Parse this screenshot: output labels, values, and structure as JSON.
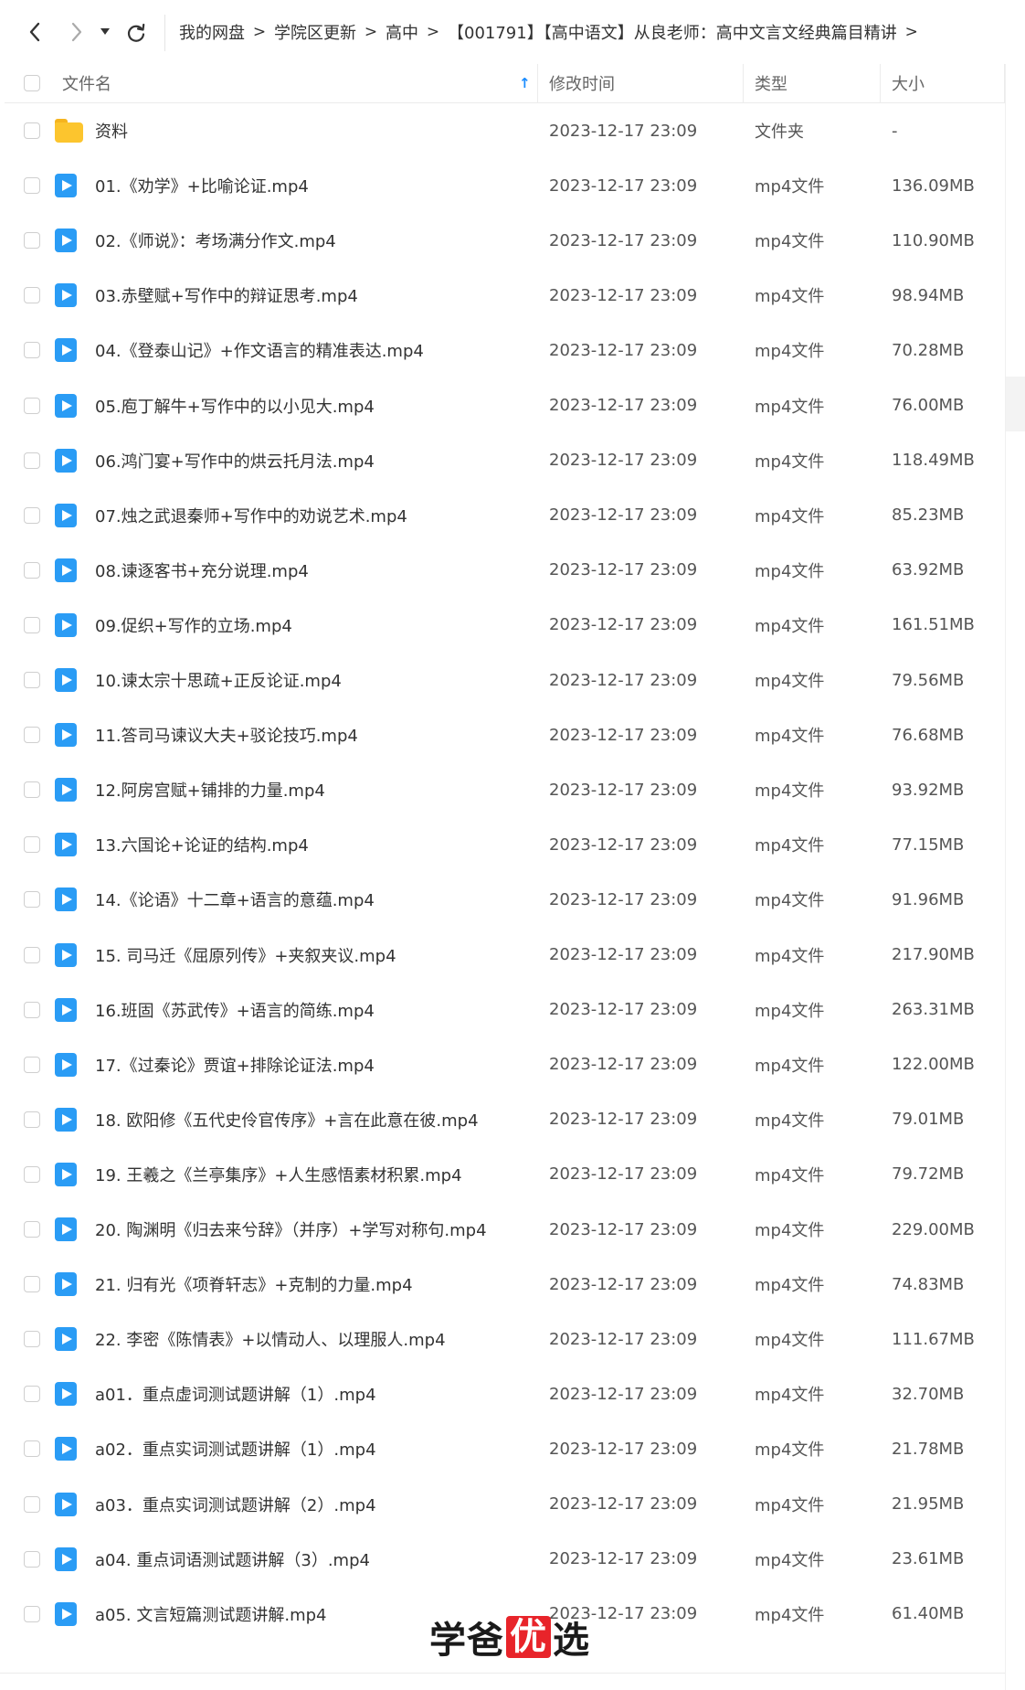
{
  "nav": {
    "breadcrumb": [
      "我的网盘",
      "学院区更新",
      "高中",
      "【001791】【高中语文】从良老师：高中文言文经典篇目精讲"
    ],
    "separator": ">"
  },
  "header": {
    "name_label": "文件名",
    "time_label": "修改时间",
    "type_label": "类型",
    "size_label": "大小",
    "sort_indicator": "↑"
  },
  "rows": [
    {
      "icon": "folder-icon",
      "name": "资料",
      "time": "2023-12-17 23:09",
      "type": "文件夹",
      "size": "-"
    },
    {
      "icon": "video-file-icon",
      "name": "01.《劝学》+比喻论证.mp4",
      "time": "2023-12-17 23:09",
      "type": "mp4文件",
      "size": "136.09MB"
    },
    {
      "icon": "video-file-icon",
      "name": "02.《师说》：考场满分作文.mp4",
      "time": "2023-12-17 23:09",
      "type": "mp4文件",
      "size": "110.90MB"
    },
    {
      "icon": "video-file-icon",
      "name": "03.赤壁赋+写作中的辩证思考.mp4",
      "time": "2023-12-17 23:09",
      "type": "mp4文件",
      "size": "98.94MB"
    },
    {
      "icon": "video-file-icon",
      "name": "04.《登泰山记》+作文语言的精准表达.mp4",
      "time": "2023-12-17 23:09",
      "type": "mp4文件",
      "size": "70.28MB"
    },
    {
      "icon": "video-file-icon",
      "name": "05.庖丁解牛+写作中的以小见大.mp4",
      "time": "2023-12-17 23:09",
      "type": "mp4文件",
      "size": "76.00MB"
    },
    {
      "icon": "video-file-icon",
      "name": "06.鸿门宴+写作中的烘云托月法.mp4",
      "time": "2023-12-17 23:09",
      "type": "mp4文件",
      "size": "118.49MB"
    },
    {
      "icon": "video-file-icon",
      "name": "07.烛之武退秦师+写作中的劝说艺术.mp4",
      "time": "2023-12-17 23:09",
      "type": "mp4文件",
      "size": "85.23MB"
    },
    {
      "icon": "video-file-icon",
      "name": "08.谏逐客书+充分说理.mp4",
      "time": "2023-12-17 23:09",
      "type": "mp4文件",
      "size": "63.92MB"
    },
    {
      "icon": "video-file-icon",
      "name": "09.促织+写作的立场.mp4",
      "time": "2023-12-17 23:09",
      "type": "mp4文件",
      "size": "161.51MB"
    },
    {
      "icon": "video-file-icon",
      "name": "10.谏太宗十思疏+正反论证.mp4",
      "time": "2023-12-17 23:09",
      "type": "mp4文件",
      "size": "79.56MB"
    },
    {
      "icon": "video-file-icon",
      "name": "11.答司马谏议大夫+驳论技巧.mp4",
      "time": "2023-12-17 23:09",
      "type": "mp4文件",
      "size": "76.68MB"
    },
    {
      "icon": "video-file-icon",
      "name": "12.阿房宫赋+铺排的力量.mp4",
      "time": "2023-12-17 23:09",
      "type": "mp4文件",
      "size": "93.92MB"
    },
    {
      "icon": "video-file-icon",
      "name": "13.六国论+论证的结构.mp4",
      "time": "2023-12-17 23:09",
      "type": "mp4文件",
      "size": "77.15MB"
    },
    {
      "icon": "video-file-icon",
      "name": "14.《论语》十二章+语言的意蕴.mp4",
      "time": "2023-12-17 23:09",
      "type": "mp4文件",
      "size": "91.96MB"
    },
    {
      "icon": "video-file-icon",
      "name": "15. 司马迁《屈原列传》+夹叙夹议.mp4",
      "time": "2023-12-17 23:09",
      "type": "mp4文件",
      "size": "217.90MB"
    },
    {
      "icon": "video-file-icon",
      "name": "16.班固《苏武传》+语言的简练.mp4",
      "time": "2023-12-17 23:09",
      "type": "mp4文件",
      "size": "263.31MB"
    },
    {
      "icon": "video-file-icon",
      "name": "17.《过秦论》贾谊+排除论证法.mp4",
      "time": "2023-12-17 23:09",
      "type": "mp4文件",
      "size": "122.00MB"
    },
    {
      "icon": "video-file-icon",
      "name": "18. 欧阳修《五代史伶官传序》+言在此意在彼.mp4",
      "time": "2023-12-17 23:09",
      "type": "mp4文件",
      "size": "79.01MB"
    },
    {
      "icon": "video-file-icon",
      "name": "19. 王羲之《兰亭集序》+人生感悟素材积累.mp4",
      "time": "2023-12-17 23:09",
      "type": "mp4文件",
      "size": "79.72MB"
    },
    {
      "icon": "video-file-icon",
      "name": "20. 陶渊明《归去来兮辞》（并序）+学写对称句.mp4",
      "time": "2023-12-17 23:09",
      "type": "mp4文件",
      "size": "229.00MB"
    },
    {
      "icon": "video-file-icon",
      "name": "21. 归有光《项脊轩志》+克制的力量.mp4",
      "time": "2023-12-17 23:09",
      "type": "mp4文件",
      "size": "74.83MB"
    },
    {
      "icon": "video-file-icon",
      "name": "22. 李密《陈情表》+以情动人、以理服人.mp4",
      "time": "2023-12-17 23:09",
      "type": "mp4文件",
      "size": "111.67MB"
    },
    {
      "icon": "video-file-icon",
      "name": "a01．重点虚词测试题讲解（1）.mp4",
      "time": "2023-12-17 23:09",
      "type": "mp4文件",
      "size": "32.70MB"
    },
    {
      "icon": "video-file-icon",
      "name": "a02．重点实词测试题讲解（1）.mp4",
      "time": "2023-12-17 23:09",
      "type": "mp4文件",
      "size": "21.78MB"
    },
    {
      "icon": "video-file-icon",
      "name": "a03．重点实词测试题讲解（2）.mp4",
      "time": "2023-12-17 23:09",
      "type": "mp4文件",
      "size": "21.95MB"
    },
    {
      "icon": "video-file-icon",
      "name": "a04. 重点词语测试题讲解（3）.mp4",
      "time": "2023-12-17 23:09",
      "type": "mp4文件",
      "size": "23.61MB"
    },
    {
      "icon": "video-file-icon",
      "name": "a05. 文言短篇测试题讲解.mp4",
      "time": "2023-12-17 23:09",
      "type": "mp4文件",
      "size": "61.40MB"
    }
  ],
  "watermark": {
    "part1": "学爸",
    "part2": "优",
    "part3": "选"
  },
  "colors": {
    "accent": "#1a8cff",
    "folder": "#fcc52e",
    "video_icon": "#2a9cf5",
    "watermark_box": "#e8242a"
  }
}
